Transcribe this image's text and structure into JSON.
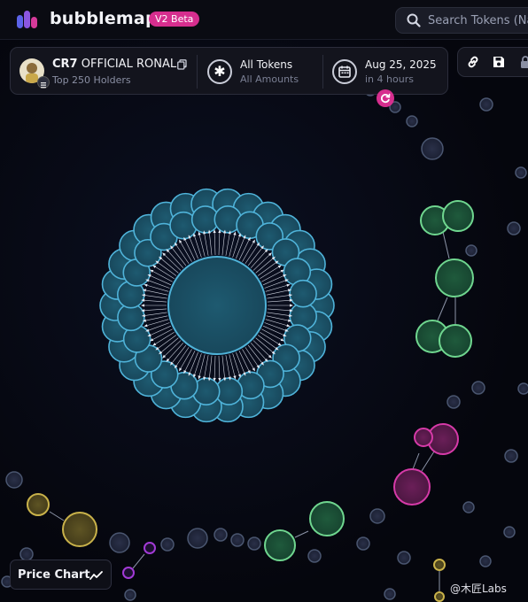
{
  "header": {
    "brand": "bubblemaps",
    "beta_badge": "V2 Beta",
    "search_placeholder": "Search Tokens (Na"
  },
  "token_card": {
    "symbol": "CR7",
    "name": "OFFICIAL RONAL...",
    "subtitle": "Top 250 Holders",
    "filter_title": "All Tokens",
    "filter_sub": "All Amounts",
    "date": "Aug 25, 2025",
    "date_sub": "in 4 hours"
  },
  "actions": [
    "link-icon",
    "save-icon",
    "lock-icon"
  ],
  "colors": {
    "accent_pink": "#d62e8e",
    "cluster_blue": "#4fb3d9",
    "cluster_green": "#6fd68f",
    "cluster_magenta": "#d63aa8",
    "cluster_yellow": "#c9b24a",
    "bubble_gray": "#4a5166"
  },
  "price_chart": {
    "label": "Price Chart"
  },
  "watermark": "@木匠Labs"
}
